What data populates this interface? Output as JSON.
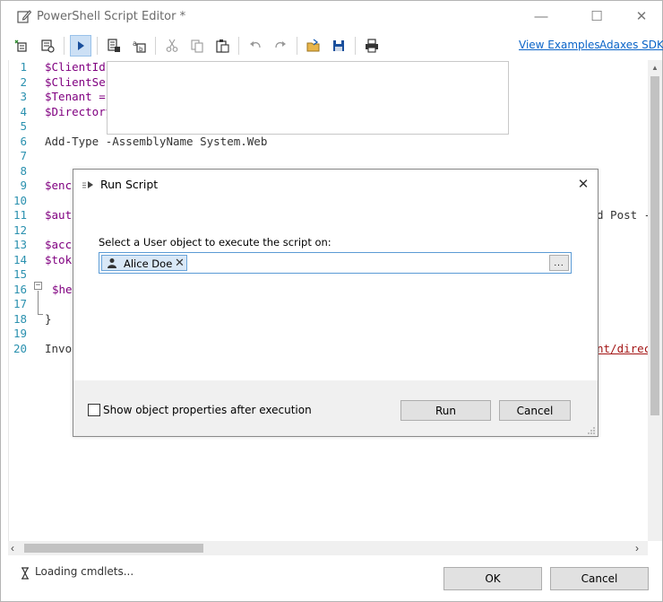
{
  "window": {
    "title": "PowerShell Script Editor *",
    "controls": {
      "minimize": "—",
      "maximize": "☐",
      "close": "✕"
    }
  },
  "toolbar": {
    "links": [
      "View Examples",
      "Adaxes SDK"
    ]
  },
  "editor": {
    "line_numbers": [
      "1",
      "2",
      "3",
      "4",
      "5",
      "6",
      "7",
      "8",
      "9",
      "10",
      "11",
      "12",
      "13",
      "14",
      "15",
      "16",
      "17",
      "18",
      "19",
      "20"
    ],
    "lines": [
      {
        "class": "var",
        "text": "$ClientId"
      },
      {
        "class": "var",
        "text": "$ClientSec"
      },
      {
        "class": "var",
        "text": "$Tenant ="
      },
      {
        "class": "var",
        "text": "$Directory"
      },
      {
        "class": "plain",
        "text": ""
      },
      {
        "class": "plain",
        "text": "Add-Type -AssemblyName System.Web"
      },
      {
        "class": "plain",
        "text": ""
      },
      {
        "class": "plain",
        "text": ""
      },
      {
        "class": "var",
        "text": "$enc"
      },
      {
        "class": "plain",
        "text": ""
      },
      {
        "class": "var",
        "text": "$aut"
      },
      {
        "class": "plain",
        "text": ""
      },
      {
        "class": "var",
        "text": "$acc"
      },
      {
        "class": "var",
        "text": "$tok"
      },
      {
        "class": "plain",
        "text": ""
      },
      {
        "class": "var",
        "text": "$hea"
      },
      {
        "class": "plain",
        "text": ""
      },
      {
        "class": "plain",
        "text": "}"
      },
      {
        "class": "plain",
        "text": ""
      },
      {
        "class": "plain",
        "text": "Invo"
      }
    ],
    "right_fragments": {
      "line11": "d Post -",
      "line20": "nt/direc"
    }
  },
  "statusbar": {
    "status": "Loading cmdlets...",
    "ok_label": "OK",
    "cancel_label": "Cancel"
  },
  "dialog": {
    "title": "Run Script",
    "close": "✕",
    "prompt": "Select a User object to execute the script on:",
    "selected_object": "Alice Doe",
    "chip_remove": "✕",
    "browse_label": "...",
    "checkbox_label": "Show object properties after execution",
    "checkbox_checked": false,
    "run_label": "Run",
    "cancel_label": "Cancel"
  },
  "colors": {
    "accent": "#0a64c8",
    "line_number": "#2b91af",
    "variable": "#800080",
    "string": "#a31515",
    "chip_bg": "#d9e8f7"
  }
}
